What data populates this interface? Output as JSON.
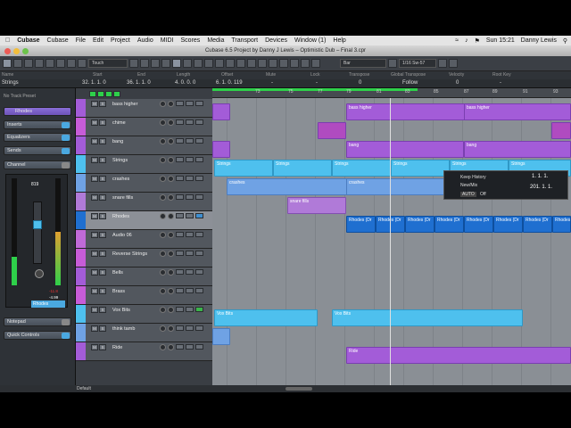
{
  "menubar": {
    "apple": "",
    "app": "Cubase",
    "items": [
      "Cubase",
      "File",
      "Edit",
      "Project",
      "Audio",
      "MIDI",
      "Scores",
      "Media",
      "Transport",
      "Devices",
      "Window (1)",
      "Help"
    ],
    "clock": "Sun 15:21",
    "user": "Danny Lewis"
  },
  "window": {
    "title": "Cubase 6.5 Project by Danny J Lewis – Optimistic Dub – Final 3.cpr"
  },
  "toolbar": {
    "mode": "Touch",
    "snap": "Bar",
    "quantize": "1/16 Sw-57"
  },
  "info": {
    "headers": [
      "Name",
      "Start",
      "End",
      "Length",
      "Offset",
      "Mute",
      "Lock",
      "Transpose",
      "Global Transpose",
      "Velocity",
      "Root Key"
    ],
    "values": [
      "Strings",
      "32. 1. 1.  0",
      "36. 1. 1.  0",
      "4. 0. 0.  0",
      "6. 1. 0. 119",
      "-",
      "-",
      "0",
      "Follow",
      "0",
      "-"
    ]
  },
  "inspector": {
    "preset": "No Track Preset",
    "track": "Rhodes",
    "sections": [
      "Inserts",
      "Equalizers",
      "Sends",
      "Channel"
    ],
    "fader_value": "819",
    "meter_readout": [
      "-11.8",
      "-4.99"
    ],
    "channel_name": "Rhodes",
    "bottom_sections": [
      "Notepad",
      "Quick Controls"
    ]
  },
  "tracks": [
    {
      "name": "bass higher",
      "color": "#a35cd8"
    },
    {
      "name": "chime",
      "color": "#c75cd8"
    },
    {
      "name": "bang",
      "color": "#a35cd8"
    },
    {
      "name": "Strings",
      "color": "#4ec0ee"
    },
    {
      "name": "crashes",
      "color": "#6fa2e4"
    },
    {
      "name": "snare fills",
      "color": "#b07ad8"
    },
    {
      "name": "Rhodes",
      "color": "#1f6fd0"
    },
    {
      "name": "Audio 06",
      "color": "#c06ad8"
    },
    {
      "name": "Reverse Strings",
      "color": "#c75cd8"
    },
    {
      "name": "Bells",
      "color": "#a35cd8"
    },
    {
      "name": "Brass",
      "color": "#c75cd8"
    },
    {
      "name": "Vox Bits",
      "color": "#4ec0ee"
    },
    {
      "name": "think tamb",
      "color": "#6fa2e4"
    },
    {
      "name": "Ride",
      "color": "#a35cd8"
    }
  ],
  "ruler": [
    "73",
    "75",
    "77",
    "79",
    "81",
    "83",
    "85",
    "87",
    "89",
    "91",
    "93"
  ],
  "parts": {
    "bass_higher": "bass higher",
    "bang": "bang",
    "strings": "Strings",
    "crashes": "crashes",
    "snare_fills": "snare fills",
    "rhodes": "Rhodes (Dr",
    "vox": "Vox Bits",
    "ride": "Ride"
  },
  "transport": {
    "history": "Keep History",
    "new_mix": "New/Mix",
    "auto": "AUTO",
    "auto_state": "Off",
    "pos1": "1. 1. 1.",
    "pos2": "201. 1. 1."
  },
  "status": {
    "default": "Default"
  }
}
